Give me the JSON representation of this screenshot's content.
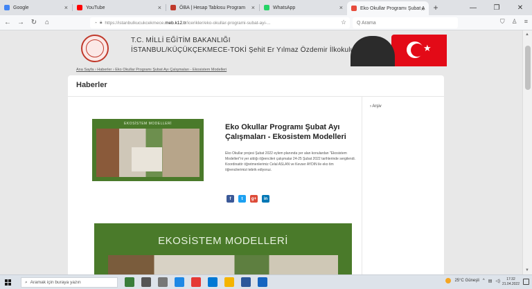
{
  "browser": {
    "tabs": [
      {
        "label": "Google",
        "color": "#4285f4",
        "active": false
      },
      {
        "label": "YouTube",
        "color": "#ff0000",
        "active": false
      },
      {
        "label": "ÖBA | Hesap Tablosu Program",
        "color": "#c0392b",
        "active": false
      },
      {
        "label": "WhatsApp",
        "color": "#25d366",
        "active": false
      },
      {
        "label": "Eko Okullar Programı Şubat A",
        "color": "#e74c3c",
        "active": true
      }
    ],
    "url_prefix": "https://istanbulkucukcekmece.",
    "url_host": "meb.k12.tr",
    "url_path": "/icerikler/eko-okullar-programi-subat-ayi-...",
    "search_placeholder": "Q Arama"
  },
  "site": {
    "ministry": "T.C. MİLLİ EĞİTİM BAKANLIĞI",
    "school": "İSTANBUL/KÜÇÜKÇEKMECE-TOKİ Şehit Er Yılmaz Özdemir İlkokulu",
    "breadcrumb": "Ana Sayfa › Haberler › Eko Okullar Programı Şubat Ayı Çalışmaları - Ekosistem Modelleri"
  },
  "page": {
    "section_title": "Haberler",
    "sidebar_link": "› Arşiv",
    "thumb_caption": "EKOSİSTEM MODELLERİ",
    "post_title": "Eko Okullar Programı Şubat Ayı Çalışmaları - Ekosistem Modelleri",
    "post_body_1": "Eko Okullar projesi Şubat 2022 eylem planında yer alan konulardan \"Ekosistem Modelleri\"ni yer aldığı öğrencileri çalışmalar 24-25 Şubat 2022 tarihlerinde sergilendi.",
    "post_body_2": "Koordinatör öğretmenlerimiz Celal ASLAN ve Kevser AYDIN ile eko tim öğrencilerimizi tebrik ediyoruz.",
    "social": [
      {
        "icon": "facebook-icon",
        "glyph": "f",
        "color": "#3b5998"
      },
      {
        "icon": "twitter-icon",
        "glyph": "t",
        "color": "#1da1f2"
      },
      {
        "icon": "google-plus-icon",
        "glyph": "g+",
        "color": "#dd4b39"
      },
      {
        "icon": "linkedin-icon",
        "glyph": "in",
        "color": "#0077b5"
      }
    ],
    "banner_title": "EKOSİSTEM MODELLERİ"
  },
  "taskbar": {
    "search_placeholder": "Aramak için buraya yazın",
    "weather": "25°C Güneşli",
    "time": "17:32",
    "date": "21.04.2022"
  }
}
